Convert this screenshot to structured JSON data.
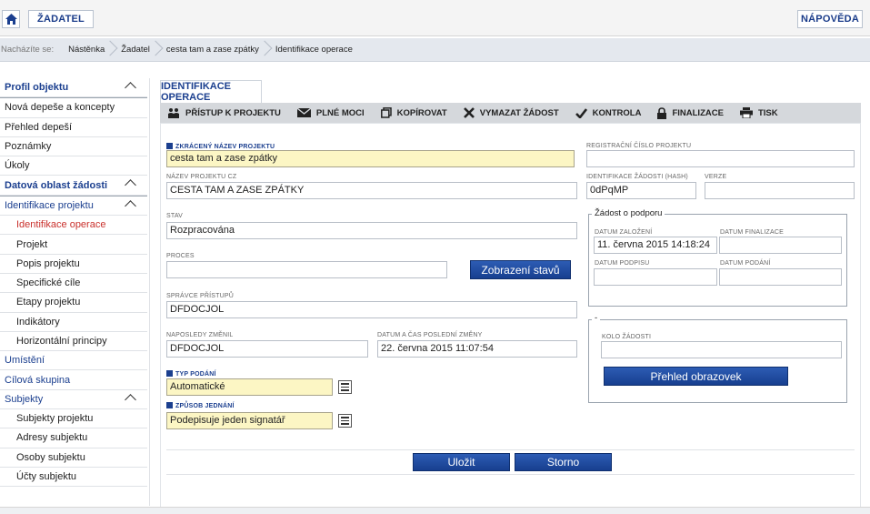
{
  "topbar": {
    "applicant_label": "ŽADATEL",
    "help_label": "NÁPOVĚDA"
  },
  "breadcrumb": {
    "label": "Nacházíte se:",
    "items": [
      "Nástěnka",
      "Žadatel",
      "cesta tam a zase zpátky",
      "Identifikace operace"
    ]
  },
  "sidebar": {
    "profile_header": "Profil objektu",
    "profile_items": [
      "Nová depeše a koncepty",
      "Přehled depeší",
      "Poznámky",
      "Úkoly"
    ],
    "data_header": "Datová oblast žádosti",
    "project_group": "Identifikace projektu",
    "project_items": [
      "Identifikace operace",
      "Projekt",
      "Popis projektu",
      "Specifické cíle",
      "Etapy projektu",
      "Indikátory",
      "Horizontální principy"
    ],
    "place": "Umístění",
    "target": "Cílová skupina",
    "subjects_group": "Subjekty",
    "subject_items": [
      "Subjekty projektu",
      "Adresy subjektu",
      "Osoby subjektu",
      "Účty subjektu"
    ]
  },
  "tab": {
    "label": "IDENTIFIKACE OPERACE"
  },
  "toolbar": {
    "access": "PŘÍSTUP K PROJEKTU",
    "powers": "PLNÉ MOCI",
    "copy": "KOPÍROVAT",
    "delete": "VYMAZAT ŽÁDOST",
    "check": "KONTROLA",
    "finalize": "FINALIZACE",
    "print": "TISK"
  },
  "form": {
    "short_name_label": "ZKRÁCENÝ NÁZEV PROJEKTU",
    "short_name_value": "cesta tam a zase zpátky",
    "name_cz_label": "NÁZEV PROJEKTU CZ",
    "name_cz_value": "CESTA TAM A ZASE ZPÁTKY",
    "status_label": "STAV",
    "status_value": "Rozpracována",
    "process_label": "PROCES",
    "process_value": "",
    "show_states_button": "Zobrazení stavů",
    "access_admin_label": "SPRÁVCE PŘÍSTUPŮ",
    "access_admin_value": "DFDOCJOL",
    "last_changed_by_label": "NAPOSLEDY ZMĚNIL",
    "last_changed_by_value": "DFDOCJOL",
    "last_change_date_label": "DATUM A ČAS POSLEDNÍ ZMĚNY",
    "last_change_date_value": "22. června 2015 11:07:54",
    "submission_type_label": "TYP PODÁNÍ",
    "submission_type_value": "Automatické",
    "action_method_label": "ZPŮSOB JEDNÁNÍ",
    "action_method_value": "Podepisuje jeden signatář",
    "reg_number_label": "REGISTRAČNÍ ČÍSLO PROJEKTU",
    "reg_number_value": "",
    "hash_label": "IDENTIFIKACE ŽÁDOSTI (HASH)",
    "hash_value": "0dPqMP",
    "version_label": "VERZE",
    "version_value": "",
    "support_legend": "Žádost o podporu",
    "founded_label": "DATUM ZALOŽENÍ",
    "founded_value": "11. června 2015 14:18:24",
    "finalized_label": "DATUM FINALIZACE",
    "finalized_value": "",
    "signed_label": "DATUM PODPISU",
    "signed_value": "",
    "submitted_label": "DATUM PODÁNÍ",
    "submitted_value": "",
    "round_legend": "-",
    "round_label": "KOLO ŽÁDOSTI",
    "round_value": "",
    "screens_button": "Přehled obrazovek"
  },
  "actions": {
    "save": "Uložit",
    "cancel": "Storno"
  },
  "colors": {
    "brand_blue": "#1b3f8f",
    "required_yellow": "#fcf6c4",
    "active_red": "#c9302c"
  }
}
